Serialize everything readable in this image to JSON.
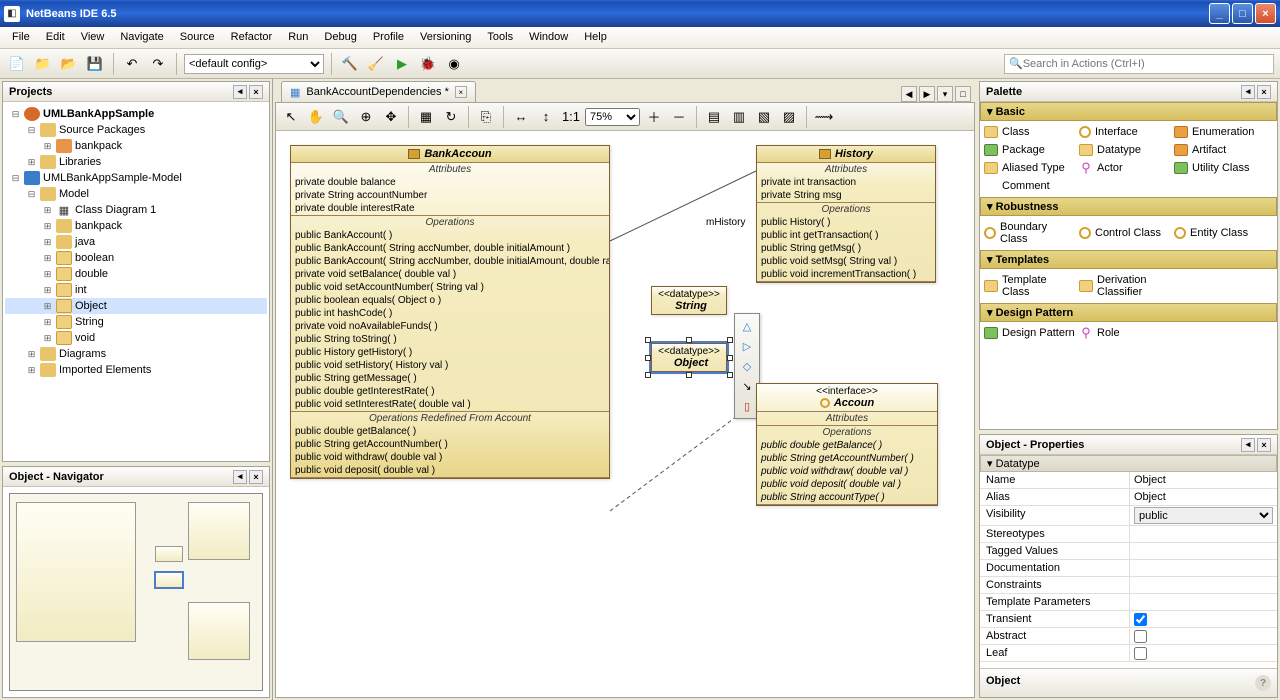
{
  "window": {
    "title": "NetBeans IDE 6.5"
  },
  "menu": [
    "File",
    "Edit",
    "View",
    "Navigate",
    "Source",
    "Refactor",
    "Run",
    "Debug",
    "Profile",
    "Versioning",
    "Tools",
    "Window",
    "Help"
  ],
  "toolbar": {
    "config": "<default config>",
    "search_placeholder": "Search in Actions (Ctrl+I)"
  },
  "projects_panel": {
    "title": "Projects"
  },
  "tree": [
    {
      "d": 0,
      "t": "-",
      "i": "uml",
      "l": "UMLBankAppSample",
      "b": true
    },
    {
      "d": 1,
      "t": "-",
      "i": "fold",
      "l": "Source Packages"
    },
    {
      "d": 2,
      "t": "+",
      "i": "pkg",
      "l": "bankpack"
    },
    {
      "d": 1,
      "t": "+",
      "i": "fold",
      "l": "Libraries"
    },
    {
      "d": 0,
      "t": "-",
      "i": "java",
      "l": "UMLBankAppSample-Model"
    },
    {
      "d": 1,
      "t": "-",
      "i": "fold",
      "l": "Model"
    },
    {
      "d": 2,
      "t": "+",
      "i": "diag",
      "l": "Class Diagram 1"
    },
    {
      "d": 2,
      "t": "+",
      "i": "fold",
      "l": "bankpack"
    },
    {
      "d": 2,
      "t": "+",
      "i": "fold",
      "l": "java"
    },
    {
      "d": 2,
      "t": "+",
      "i": "type",
      "l": "boolean"
    },
    {
      "d": 2,
      "t": "+",
      "i": "type",
      "l": "double"
    },
    {
      "d": 2,
      "t": "+",
      "i": "type",
      "l": "int"
    },
    {
      "d": 2,
      "t": "+",
      "i": "type",
      "l": "Object",
      "sel": true
    },
    {
      "d": 2,
      "t": "+",
      "i": "type",
      "l": "String"
    },
    {
      "d": 2,
      "t": "+",
      "i": "type",
      "l": "void"
    },
    {
      "d": 1,
      "t": "+",
      "i": "fold",
      "l": "Diagrams"
    },
    {
      "d": 1,
      "t": "+",
      "i": "fold",
      "l": "Imported Elements"
    }
  ],
  "navigator_panel": {
    "title": "Object - Navigator"
  },
  "editor": {
    "tab_label": "BankAccountDependencies *",
    "zoom": "75%",
    "link_label": "mHistory",
    "bankaccount": {
      "name": "BankAccoun",
      "attrs": [
        "private double balance",
        "private String accountNumber",
        "private double interestRate"
      ],
      "ops": [
        "public BankAccount( )",
        "public BankAccount( String accNumber, double initialAmount )",
        "public BankAccount( String accNumber, double initialAmount, double rate )",
        "private void  setBalance( double val )",
        "public void  setAccountNumber( String val )",
        "public boolean  equals( Object o )",
        "public int  hashCode( )",
        "private void  noAvailableFunds( )",
        "public String  toString( )",
        "public History  getHistory( )",
        "public void  setHistory( History val )",
        "public String  getMessage( )",
        "public double  getInterestRate( )",
        "public void  setInterestRate( double val )"
      ],
      "redef_title": "Operations Redefined From Account",
      "redef": [
        "public double  getBalance( )",
        "public String  getAccountNumber( )",
        "public void  withdraw( double val )",
        "public void  deposit( double val )"
      ]
    },
    "history": {
      "name": "History",
      "attrs": [
        "private int transaction",
        "private String msg"
      ],
      "ops": [
        "public History( )",
        "public int  getTransaction( )",
        "public String  getMsg( )",
        "public void  setMsg( String val )",
        "public void  incrementTransaction( )"
      ]
    },
    "string": {
      "stereo": "<<datatype>>",
      "name": "String"
    },
    "object": {
      "stereo": "<<datatype>>",
      "name": "Object"
    },
    "account": {
      "stereo": "<<interface>>",
      "name": "Accoun",
      "ops": [
        "public double  getBalance( )",
        "public String  getAccountNumber( )",
        "public void  withdraw( double val )",
        "public void  deposit( double val )",
        "public String  accountType( )"
      ]
    }
  },
  "palette": {
    "title": "Palette",
    "groups": [
      {
        "name": "Basic",
        "items": [
          {
            "i": "cls",
            "l": "Class"
          },
          {
            "i": "itf",
            "l": "Interface"
          },
          {
            "i": "enum",
            "l": "Enumeration"
          },
          {
            "i": "green",
            "l": "Package"
          },
          {
            "i": "cls",
            "l": "Datatype"
          },
          {
            "i": "enum",
            "l": "Artifact"
          },
          {
            "i": "cls",
            "l": "Aliased Type"
          },
          {
            "i": "act",
            "l": "Actor"
          },
          {
            "i": "green",
            "l": "Utility Class"
          },
          {
            "i": "",
            "l": "Comment"
          }
        ]
      },
      {
        "name": "Robustness",
        "items": [
          {
            "i": "itf",
            "l": "Boundary Class"
          },
          {
            "i": "itf",
            "l": "Control Class"
          },
          {
            "i": "itf",
            "l": "Entity Class"
          }
        ]
      },
      {
        "name": "Templates",
        "items": [
          {
            "i": "cls",
            "l": "Template Class"
          },
          {
            "i": "cls",
            "l": "Derivation Classifier"
          }
        ]
      },
      {
        "name": "Design Pattern",
        "items": [
          {
            "i": "green",
            "l": "Design Pattern"
          },
          {
            "i": "act",
            "l": "Role"
          }
        ]
      }
    ]
  },
  "properties": {
    "title": "Object - Properties",
    "group": "Datatype",
    "rows": [
      {
        "k": "Name",
        "v": "Object"
      },
      {
        "k": "Alias",
        "v": "Object"
      },
      {
        "k": "Visibility",
        "v": "public",
        "select": true
      },
      {
        "k": "Stereotypes",
        "v": ""
      },
      {
        "k": "Tagged Values",
        "v": ""
      },
      {
        "k": "Documentation",
        "v": ""
      },
      {
        "k": "Constraints",
        "v": ""
      },
      {
        "k": "Template Parameters",
        "v": ""
      },
      {
        "k": "Transient",
        "cb": true,
        "checked": true
      },
      {
        "k": "Abstract",
        "cb": true,
        "checked": false
      },
      {
        "k": "Leaf",
        "cb": true,
        "checked": false
      }
    ],
    "footer": "Object"
  },
  "section_labels": {
    "attributes": "Attributes",
    "operations": "Operations"
  }
}
